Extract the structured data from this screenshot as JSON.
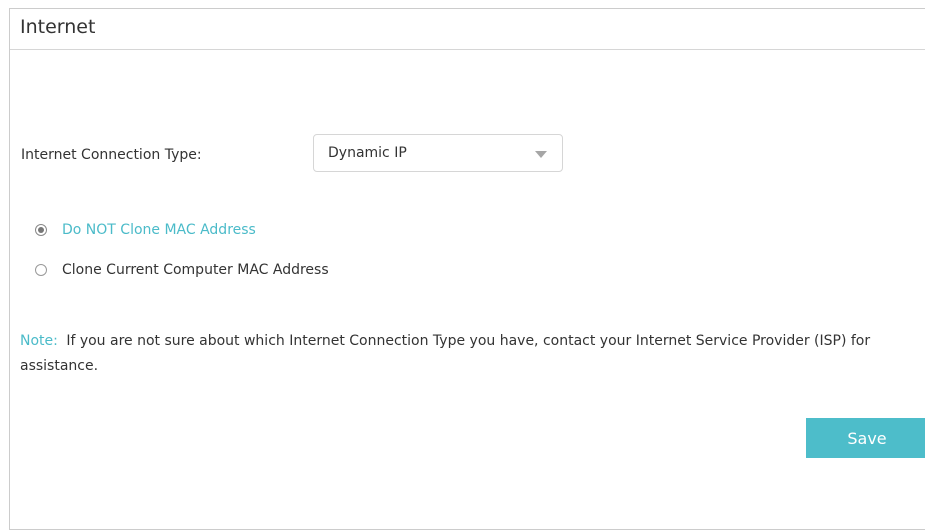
{
  "section": {
    "title": "Internet"
  },
  "connection": {
    "label": "Internet Connection Type:",
    "selected": "Dynamic IP"
  },
  "mac_options": [
    {
      "label": "Do NOT Clone MAC Address",
      "checked": true
    },
    {
      "label": "Clone Current Computer MAC Address",
      "checked": false
    }
  ],
  "note": {
    "prefix": "Note:",
    "text": "If you are not sure about which Internet Connection Type you have, contact your Internet Service Provider (ISP) for assistance."
  },
  "actions": {
    "save_label": "Save"
  },
  "colors": {
    "accent": "#4bbbc9",
    "button": "#4dbdca"
  },
  "icons": {
    "dropdown": "chevron-down-icon"
  }
}
